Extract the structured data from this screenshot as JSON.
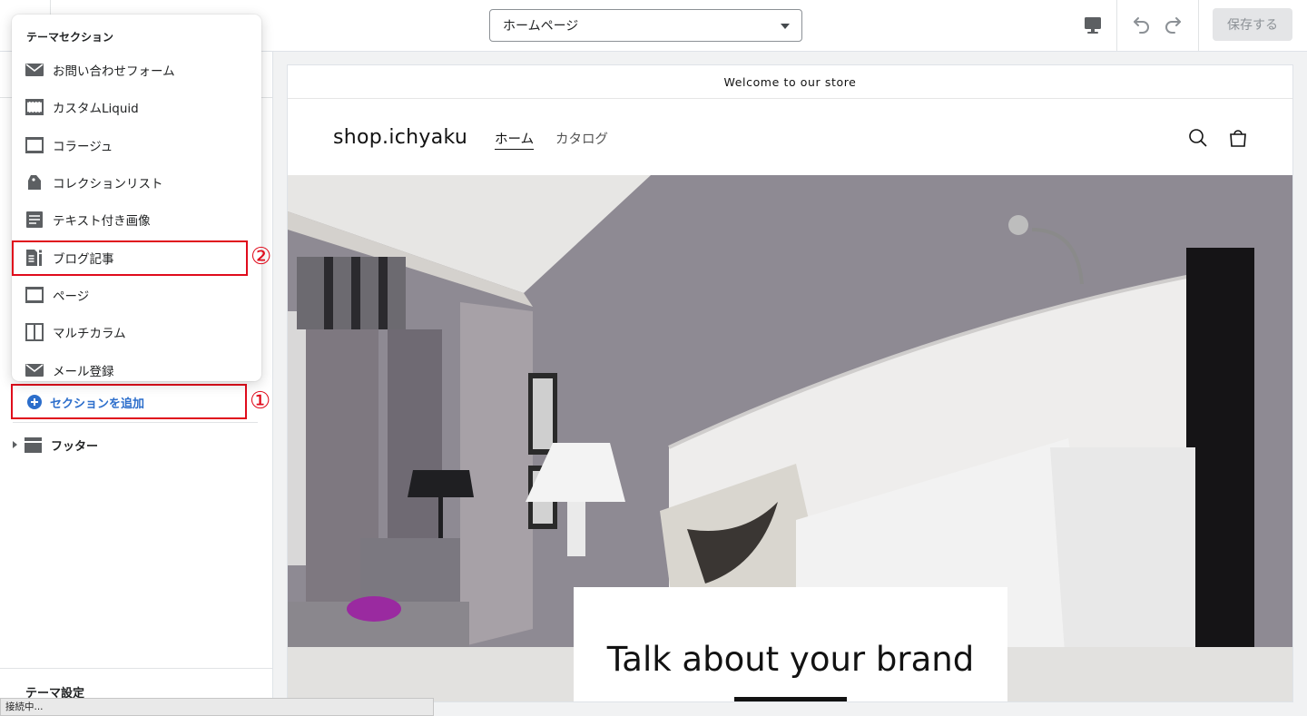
{
  "topbar": {
    "page_select_value": "ホームページ",
    "save_label": "保存する"
  },
  "popover": {
    "title": "テーマセクション",
    "items": [
      {
        "label": "お問い合わせフォーム",
        "icon": "envelope-icon"
      },
      {
        "label": "カスタムLiquid",
        "icon": "section-block-icon"
      },
      {
        "label": "コラージュ",
        "icon": "section-block-icon"
      },
      {
        "label": "コレクションリスト",
        "icon": "tags-icon"
      },
      {
        "label": "テキスト付き画像",
        "icon": "text-document-icon"
      },
      {
        "label": "ブログ記事",
        "icon": "blog-icon"
      },
      {
        "label": "ページ",
        "icon": "section-block-icon"
      },
      {
        "label": "マルチカラム",
        "icon": "columns-icon"
      },
      {
        "label": "メール登録",
        "icon": "envelope-icon"
      }
    ]
  },
  "sidebar": {
    "add_section_label": "セクションを追加",
    "footer_label": "フッター",
    "theme_settings_label": "テーマ設定"
  },
  "annotations": {
    "one": "①",
    "two": "②",
    "color": "#e00b1c"
  },
  "preview": {
    "announcement": "Welcome to our store",
    "logo": "shop.ichyaku",
    "nav_home": "ホーム",
    "nav_catalog": "カタログ",
    "hero_title": "Talk about your brand"
  },
  "status": {
    "text": "接続中..."
  },
  "colors": {
    "accent": "#2c6ecb",
    "annotation_red": "#e00b1c"
  }
}
